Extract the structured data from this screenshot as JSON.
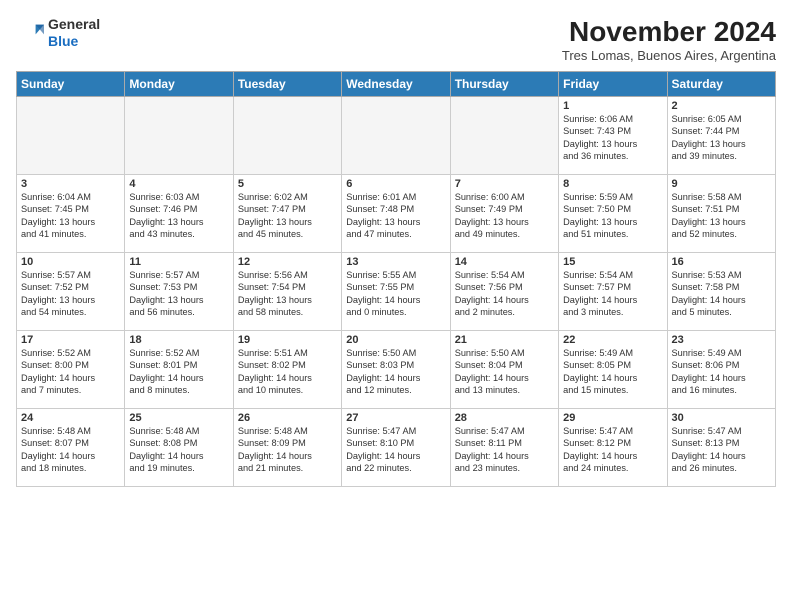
{
  "header": {
    "logo": {
      "general": "General",
      "blue": "Blue"
    },
    "title": "November 2024",
    "subtitle": "Tres Lomas, Buenos Aires, Argentina"
  },
  "weekdays": [
    "Sunday",
    "Monday",
    "Tuesday",
    "Wednesday",
    "Thursday",
    "Friday",
    "Saturday"
  ],
  "weeks": [
    [
      {
        "day": "",
        "info": ""
      },
      {
        "day": "",
        "info": ""
      },
      {
        "day": "",
        "info": ""
      },
      {
        "day": "",
        "info": ""
      },
      {
        "day": "",
        "info": ""
      },
      {
        "day": "1",
        "info": "Sunrise: 6:06 AM\nSunset: 7:43 PM\nDaylight: 13 hours\nand 36 minutes."
      },
      {
        "day": "2",
        "info": "Sunrise: 6:05 AM\nSunset: 7:44 PM\nDaylight: 13 hours\nand 39 minutes."
      }
    ],
    [
      {
        "day": "3",
        "info": "Sunrise: 6:04 AM\nSunset: 7:45 PM\nDaylight: 13 hours\nand 41 minutes."
      },
      {
        "day": "4",
        "info": "Sunrise: 6:03 AM\nSunset: 7:46 PM\nDaylight: 13 hours\nand 43 minutes."
      },
      {
        "day": "5",
        "info": "Sunrise: 6:02 AM\nSunset: 7:47 PM\nDaylight: 13 hours\nand 45 minutes."
      },
      {
        "day": "6",
        "info": "Sunrise: 6:01 AM\nSunset: 7:48 PM\nDaylight: 13 hours\nand 47 minutes."
      },
      {
        "day": "7",
        "info": "Sunrise: 6:00 AM\nSunset: 7:49 PM\nDaylight: 13 hours\nand 49 minutes."
      },
      {
        "day": "8",
        "info": "Sunrise: 5:59 AM\nSunset: 7:50 PM\nDaylight: 13 hours\nand 51 minutes."
      },
      {
        "day": "9",
        "info": "Sunrise: 5:58 AM\nSunset: 7:51 PM\nDaylight: 13 hours\nand 52 minutes."
      }
    ],
    [
      {
        "day": "10",
        "info": "Sunrise: 5:57 AM\nSunset: 7:52 PM\nDaylight: 13 hours\nand 54 minutes."
      },
      {
        "day": "11",
        "info": "Sunrise: 5:57 AM\nSunset: 7:53 PM\nDaylight: 13 hours\nand 56 minutes."
      },
      {
        "day": "12",
        "info": "Sunrise: 5:56 AM\nSunset: 7:54 PM\nDaylight: 13 hours\nand 58 minutes."
      },
      {
        "day": "13",
        "info": "Sunrise: 5:55 AM\nSunset: 7:55 PM\nDaylight: 14 hours\nand 0 minutes."
      },
      {
        "day": "14",
        "info": "Sunrise: 5:54 AM\nSunset: 7:56 PM\nDaylight: 14 hours\nand 2 minutes."
      },
      {
        "day": "15",
        "info": "Sunrise: 5:54 AM\nSunset: 7:57 PM\nDaylight: 14 hours\nand 3 minutes."
      },
      {
        "day": "16",
        "info": "Sunrise: 5:53 AM\nSunset: 7:58 PM\nDaylight: 14 hours\nand 5 minutes."
      }
    ],
    [
      {
        "day": "17",
        "info": "Sunrise: 5:52 AM\nSunset: 8:00 PM\nDaylight: 14 hours\nand 7 minutes."
      },
      {
        "day": "18",
        "info": "Sunrise: 5:52 AM\nSunset: 8:01 PM\nDaylight: 14 hours\nand 8 minutes."
      },
      {
        "day": "19",
        "info": "Sunrise: 5:51 AM\nSunset: 8:02 PM\nDaylight: 14 hours\nand 10 minutes."
      },
      {
        "day": "20",
        "info": "Sunrise: 5:50 AM\nSunset: 8:03 PM\nDaylight: 14 hours\nand 12 minutes."
      },
      {
        "day": "21",
        "info": "Sunrise: 5:50 AM\nSunset: 8:04 PM\nDaylight: 14 hours\nand 13 minutes."
      },
      {
        "day": "22",
        "info": "Sunrise: 5:49 AM\nSunset: 8:05 PM\nDaylight: 14 hours\nand 15 minutes."
      },
      {
        "day": "23",
        "info": "Sunrise: 5:49 AM\nSunset: 8:06 PM\nDaylight: 14 hours\nand 16 minutes."
      }
    ],
    [
      {
        "day": "24",
        "info": "Sunrise: 5:48 AM\nSunset: 8:07 PM\nDaylight: 14 hours\nand 18 minutes."
      },
      {
        "day": "25",
        "info": "Sunrise: 5:48 AM\nSunset: 8:08 PM\nDaylight: 14 hours\nand 19 minutes."
      },
      {
        "day": "26",
        "info": "Sunrise: 5:48 AM\nSunset: 8:09 PM\nDaylight: 14 hours\nand 21 minutes."
      },
      {
        "day": "27",
        "info": "Sunrise: 5:47 AM\nSunset: 8:10 PM\nDaylight: 14 hours\nand 22 minutes."
      },
      {
        "day": "28",
        "info": "Sunrise: 5:47 AM\nSunset: 8:11 PM\nDaylight: 14 hours\nand 23 minutes."
      },
      {
        "day": "29",
        "info": "Sunrise: 5:47 AM\nSunset: 8:12 PM\nDaylight: 14 hours\nand 24 minutes."
      },
      {
        "day": "30",
        "info": "Sunrise: 5:47 AM\nSunset: 8:13 PM\nDaylight: 14 hours\nand 26 minutes."
      }
    ]
  ]
}
